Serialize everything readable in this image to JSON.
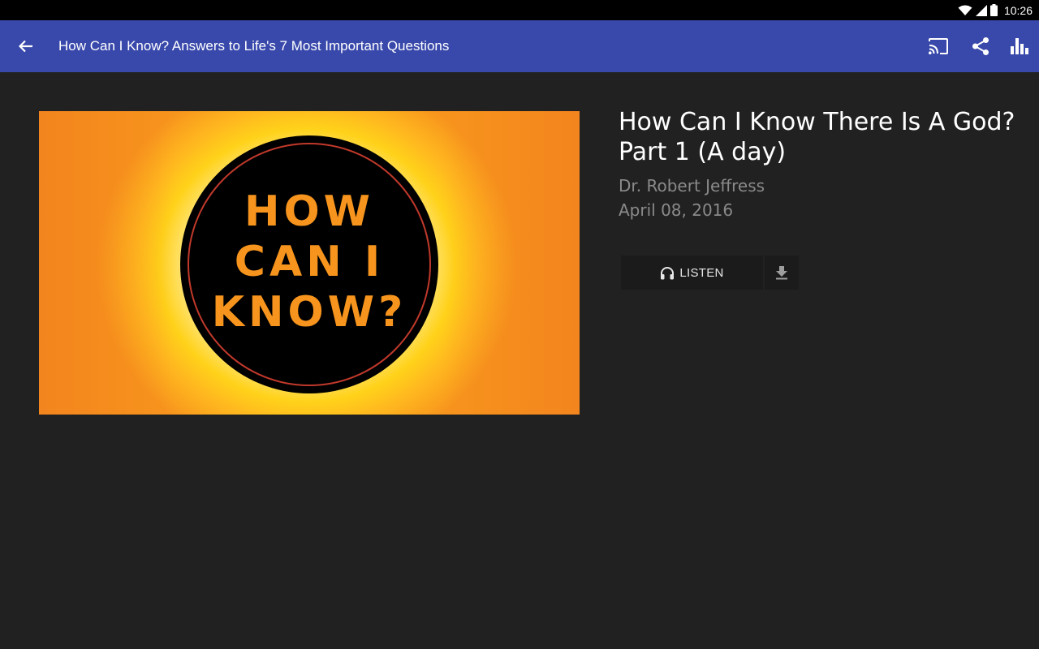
{
  "status_bar": {
    "time": "10:26",
    "icons": [
      "wifi-icon",
      "signal-icon",
      "battery-icon"
    ]
  },
  "toolbar": {
    "title": "How Can I Know? Answers to Life's 7 Most Important Questions",
    "back_icon": "arrow-back-icon",
    "actions": [
      "cast-icon",
      "share-icon",
      "stats-icon"
    ],
    "color": "#3949ab"
  },
  "artwork": {
    "line1": "HOW",
    "line2": "CAN I",
    "line3": "KNOW?"
  },
  "episode": {
    "title": "How Can I Know There Is A God? Part 1 (A day)",
    "author": "Dr. Robert Jeffress",
    "date": "April 08, 2016"
  },
  "actions": {
    "listen_label": "LISTEN",
    "listen_icon": "headphones-icon",
    "download_icon": "download-icon"
  }
}
